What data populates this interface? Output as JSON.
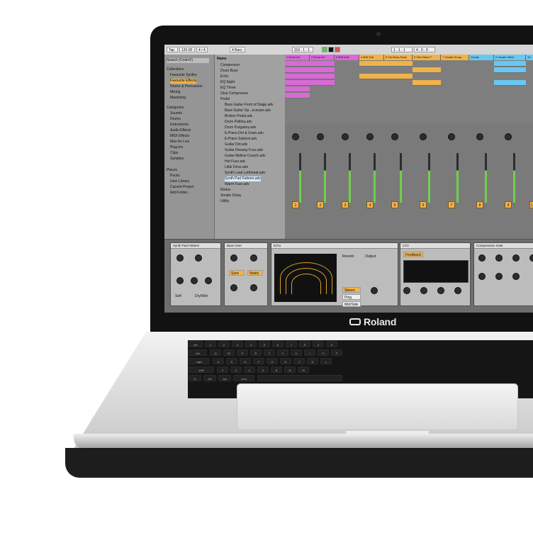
{
  "brand": {
    "name": "Roland"
  },
  "screen": {
    "topbar": {
      "tap": "Tap",
      "bpm": "120.00",
      "sig": "4 / 4",
      "bars": "4 Bars",
      "pos": "119 . 1 . 1",
      "loop": "1 . 1 . 1",
      "loop_len": "4 . 0 . 0"
    },
    "browser": {
      "title": "Search (Cmd+F)",
      "collections_title": "Collections",
      "collections": [
        "Favourite Synths",
        "Favourite Effects",
        "Drums & Percussion",
        "Mixing",
        "Mastering"
      ],
      "categories_title": "Categories",
      "categories": [
        "Sounds",
        "Drums",
        "Instruments",
        "Audio Effects",
        "MIDI Effects",
        "Max for Live",
        "Plug-ins",
        "Clips",
        "Samples"
      ],
      "places_title": "Places",
      "places": [
        "Packs",
        "User Library",
        "Current Project",
        "Add Folder..."
      ],
      "name_header": "Name",
      "files": [
        "Compressor",
        "Drum Buss",
        "Echo",
        "EQ Eight",
        "EQ Three",
        "Glue Compressor",
        "Pedal",
        "Bass Guitar Front of Stage.adv",
        "Bass Guitar Op...ecessor.adv",
        "Broken Pedal.adv",
        "Drum Pattina.adv",
        "Drum Purgatory.adv",
        "E-Piano Dirt & Grain.adv",
        "E-Piano Subtext.adv",
        "Guitar Dirt.adv",
        "Guitar Dreamy Fuzz.adv",
        "Guitar Mellow Crunch.adv",
        "Hot Fuzz.adv",
        "Little Drive.adv",
        "Synth Lead Luthmeat.adv",
        "Synth Pad Fatteen.adv",
        "Warm Fuzz.adv",
        "Redux",
        "Simple Delay",
        "Utility"
      ]
    },
    "tracks": [
      "1 Drum Kit",
      "2 Drum Kit",
      "3 808 Kick",
      "4 808 Sub",
      "5 Ost Bass Rack",
      "6 Velo Bass P",
      "7 Vocals Group",
      "Vocals",
      "9 Vocals Glitch",
      "10"
    ],
    "mixer_numbers": [
      "1",
      "2",
      "3",
      "4",
      "5",
      "6",
      "7",
      "8",
      "9",
      "10"
    ],
    "devices": [
      {
        "title": "Synth Pad Fatteen",
        "labels": [
          "Gain",
          "Output",
          "Bass",
          "Mid",
          "Treble",
          "Soft",
          "Dry/Wet"
        ]
      },
      {
        "title": "Bass Over",
        "labels": [
          "Left",
          "Right",
          "Sync",
          "Notes",
          "Input",
          "Feedback"
        ]
      },
      {
        "title": "Echo",
        "labels": [
          "Filter HP",
          "Mod",
          "Character",
          "Reverb",
          "Output",
          "Stereo",
          "Ping Pong",
          "Mid/Side",
          "Dry/Wet"
        ]
      },
      {
        "title": "LFO",
        "labels": [
          "Feedback",
          "Rate",
          "Depth",
          "Offset",
          "Phase"
        ]
      },
      {
        "title": "Compression Gate",
        "labels": [
          "Threshold",
          "Ratio",
          "Attack",
          "Release",
          "Knee",
          "Gain",
          "Dry/Wet"
        ]
      }
    ]
  }
}
